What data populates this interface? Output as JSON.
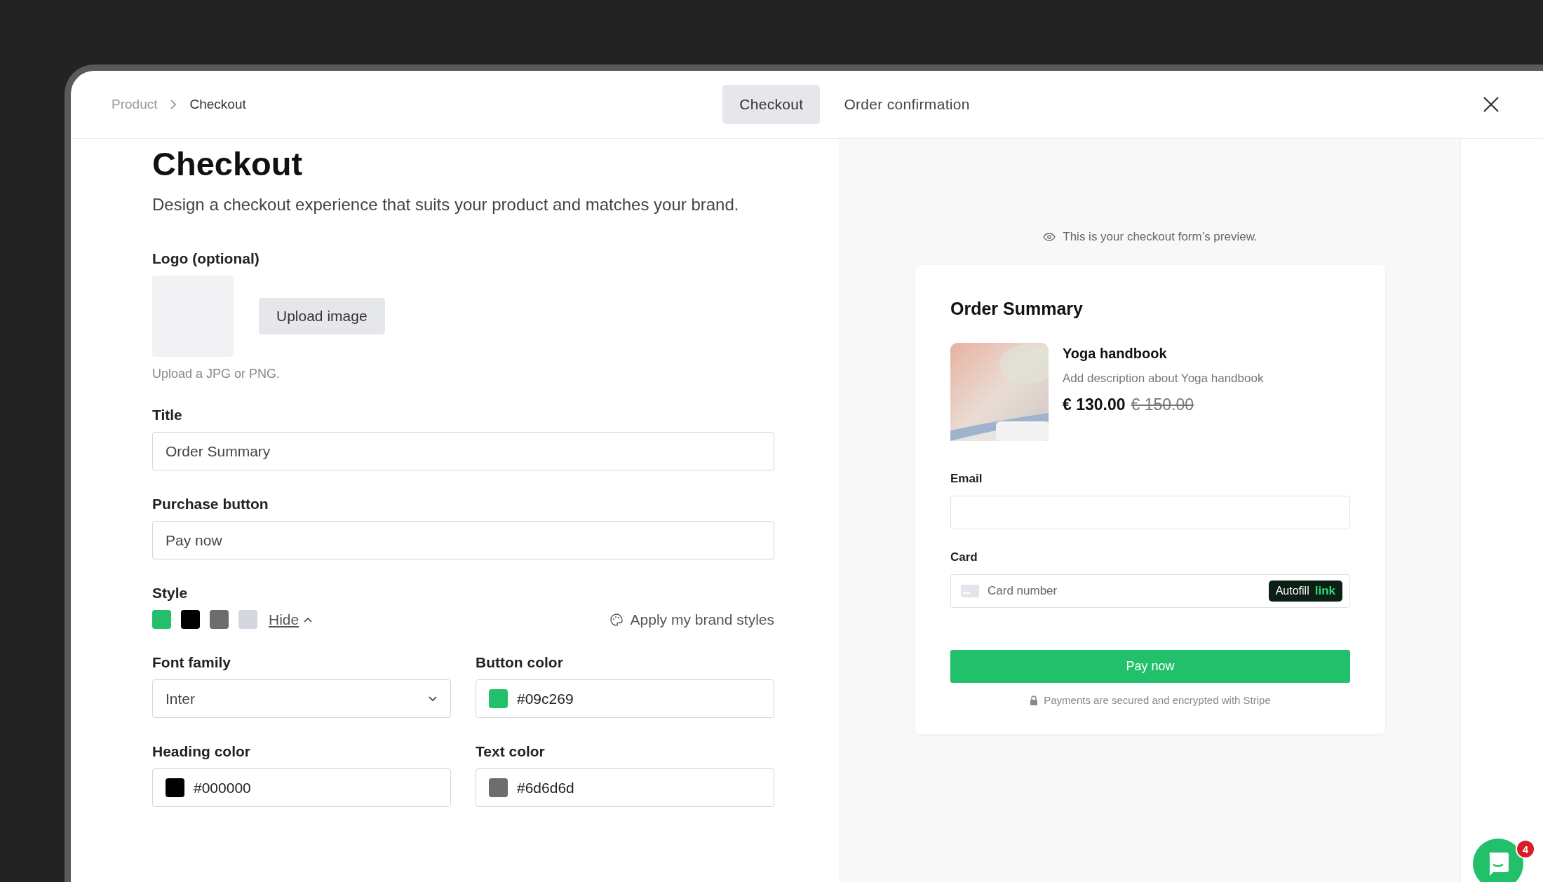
{
  "breadcrumbs": [
    {
      "label": "Product",
      "selected": false
    },
    {
      "label": "Checkout",
      "selected": true
    }
  ],
  "tabs": [
    {
      "label": "Checkout",
      "selected": true
    },
    {
      "label": "Order confirmation",
      "selected": false
    }
  ],
  "heading": "Checkout",
  "description": "Design a checkout experience that suits your product and matches your brand.",
  "logo": {
    "label": "Logo (optional)",
    "button": "Upload image",
    "hint": "Upload a JPG or PNG."
  },
  "title_field": {
    "label": "Title",
    "value": "Order Summary"
  },
  "purchase_field": {
    "label": "Purchase button",
    "value": "Pay now"
  },
  "style": {
    "label": "Style",
    "swatches": [
      {
        "color": "#22c06a"
      },
      {
        "color": "#000000"
      },
      {
        "color": "#6d6d6d"
      },
      {
        "color": "#d5d7de"
      }
    ],
    "toggle": "Hide",
    "expanded": true,
    "brand_button": "Apply my brand styles"
  },
  "fields": [
    {
      "kind": "select",
      "label": "Font family",
      "value": "Inter"
    },
    {
      "kind": "color",
      "label": "Button color",
      "value": "#09c269",
      "color": "#22c06a"
    },
    {
      "kind": "color",
      "label": "Heading color",
      "value": "#000000",
      "color": "#000000"
    },
    {
      "kind": "color",
      "label": "Text color",
      "value": "#6d6d6d",
      "color": "#6d6d6d"
    }
  ],
  "preview": {
    "note": "This is your checkout form’s preview.",
    "card": {
      "title": "Order Summary",
      "product": {
        "name": "Yoga handbook",
        "description": "Add description about Yoga handbook",
        "price": "€ 130.00",
        "old_price": "€ 150.00"
      },
      "email_label": "Email",
      "card_label": "Card",
      "card_placeholder": "Card number",
      "autofill": "Autofill",
      "autofill_link": "link",
      "pay_button": "Pay now",
      "secure_note": "Payments are secured and encrypted with Stripe"
    }
  },
  "chat": {
    "badge": "4"
  }
}
